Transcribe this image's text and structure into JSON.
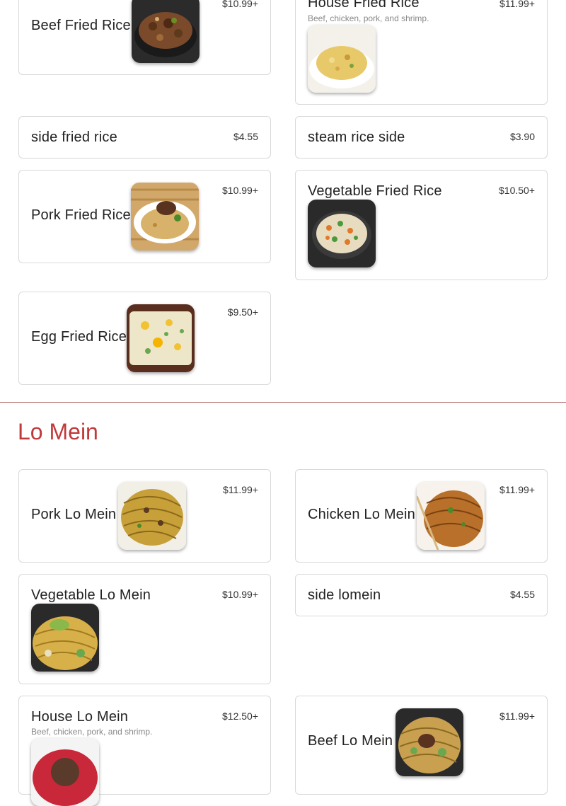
{
  "colors": {
    "accent": "#c0393b",
    "divider": "#b3706e",
    "card_border": "#d9d9d9"
  },
  "rice_items": {
    "beef_fried_rice": {
      "name": "Beef Fried Rice",
      "price": "$10.99+"
    },
    "house_fried_rice": {
      "name": "House Fried Rice",
      "price": "$11.99+",
      "description": "Beef, chicken, pork, and shrimp."
    },
    "side_fried_rice": {
      "name": "side fried rice",
      "price": "$4.55"
    },
    "steam_rice_side": {
      "name": "steam rice side",
      "price": "$3.90"
    },
    "pork_fried_rice": {
      "name": "Pork Fried Rice",
      "price": "$10.99+"
    },
    "vegetable_fried_rice": {
      "name": "Vegetable Fried Rice",
      "price": "$10.50+"
    },
    "egg_fried_rice": {
      "name": "Egg Fried Rice",
      "price": "$9.50+"
    }
  },
  "lo_mein": {
    "title": "Lo Mein",
    "items": {
      "pork_lo_mein": {
        "name": "Pork Lo Mein",
        "price": "$11.99+"
      },
      "chicken_lo_mein": {
        "name": "Chicken Lo Mein",
        "price": "$11.99+"
      },
      "vegetable_lo_mein": {
        "name": "Vegetable Lo Mein",
        "price": "$10.99+"
      },
      "side_lomein": {
        "name": "side lomein",
        "price": "$4.55"
      },
      "house_lo_mein": {
        "name": "House Lo Mein",
        "price": "$12.50+",
        "description": "Beef, chicken, pork, and shrimp."
      },
      "beef_lo_mein": {
        "name": "Beef Lo Mein",
        "price": "$11.99+"
      }
    }
  },
  "icons": {
    "food_photo": "food-photo-icon"
  }
}
